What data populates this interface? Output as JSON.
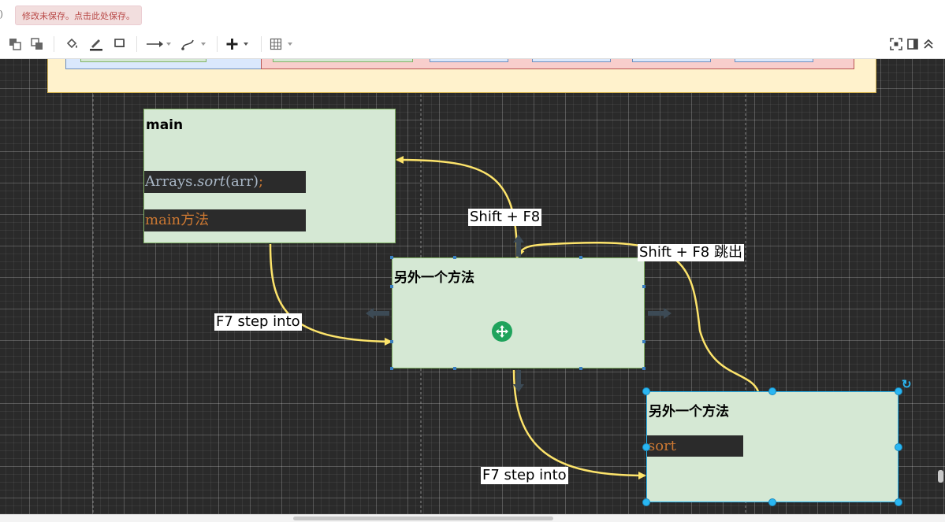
{
  "header": {
    "left_mark": ")",
    "unsaved_notice": "修改未保存。点击此处保存。"
  },
  "toolbar": {
    "items": [
      {
        "name": "to-front-icon"
      },
      {
        "name": "to-back-icon"
      },
      {
        "name": "fill-color-icon"
      },
      {
        "name": "line-color-icon"
      },
      {
        "name": "shadow-icon"
      },
      {
        "name": "connection-icon"
      },
      {
        "name": "waypoints-icon"
      },
      {
        "name": "insert-icon"
      },
      {
        "name": "table-icon"
      },
      {
        "name": "fit-icon"
      },
      {
        "name": "format-panel-icon"
      },
      {
        "name": "collapse-icon"
      }
    ]
  },
  "diagram": {
    "nodes": {
      "main": {
        "title": "main",
        "code_line": "Arrays.sort(arr);",
        "code_parts": {
          "prefix": "Arrays.",
          "method": "sort",
          "args": "(arr)",
          "semicolon": ";"
        },
        "label_line": "main方法"
      },
      "other_method": {
        "title": "另外一个方法"
      },
      "other_method_sort": {
        "title": "另外一个方法",
        "code_line": "sort"
      }
    },
    "edges": [
      {
        "from": "main",
        "to": "other_method",
        "label": "F7 step into"
      },
      {
        "from": "other_method",
        "to": "main",
        "label": "Shift + F8"
      },
      {
        "from": "other_method",
        "to": "other_method_sort",
        "label": "F7 step into"
      },
      {
        "from": "other_method_sort",
        "to": "other_method",
        "label": "Shift + F8 跳出"
      }
    ],
    "colors": {
      "canvas": "#2a2a2a",
      "node_fill": "#d5e8d4",
      "node_border": "#82b366",
      "edge": "#fde46b",
      "container_fill": "#fff2cc",
      "selection": "#29b6f2",
      "code_bg": "#2b2b2b",
      "code_plain": "#a9b7c6",
      "code_accent": "#cc7832"
    }
  }
}
